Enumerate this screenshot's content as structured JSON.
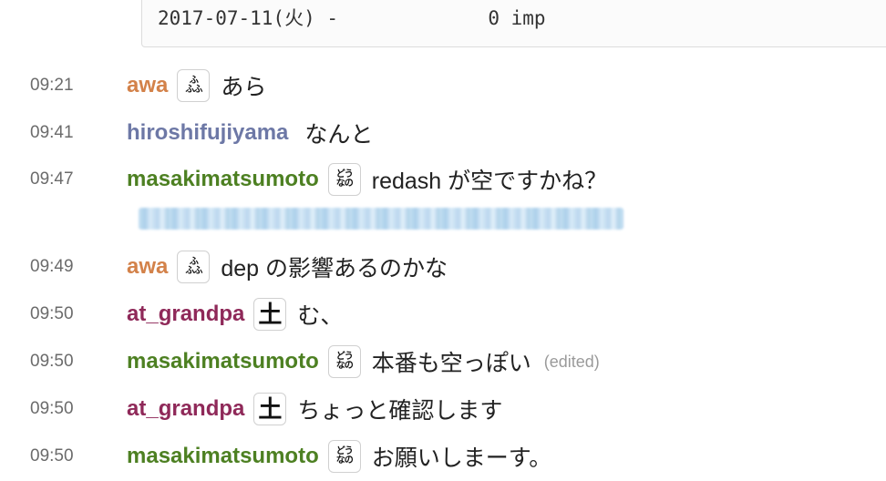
{
  "code_block": {
    "line": "2017-07-11(火) -             0 imp"
  },
  "colors": {
    "awa": "#d3824a",
    "hiroshifujiyama": "#6d78a6",
    "masakimatsumoto": "#4d8022",
    "at_grandpa": "#8f2959"
  },
  "messages": [
    {
      "time": "09:21",
      "user": "awa",
      "emoji": "fufufu-icon",
      "text": "あら"
    },
    {
      "time": "09:41",
      "user": "hiroshifujiyama",
      "text": "なんと"
    },
    {
      "time": "09:47",
      "user": "masakimatsumoto",
      "emoji": "dounano-icon",
      "text": "redash が空ですかね？"
    },
    {
      "time": "09:49",
      "user": "awa",
      "emoji": "fufufu-icon",
      "text": "dep の影響あるのかな"
    },
    {
      "time": "09:50",
      "user": "at_grandpa",
      "emoji": "tsuchi-icon",
      "text": "む、"
    },
    {
      "time": "09:50",
      "user": "masakimatsumoto",
      "emoji": "dounano-icon",
      "text": "本番も空っぽい",
      "edited": "(edited)"
    },
    {
      "time": "09:50",
      "user": "at_grandpa",
      "emoji": "tsuchi-icon",
      "text": "ちょっと確認します"
    },
    {
      "time": "09:50",
      "user": "masakimatsumoto",
      "emoji": "dounano-icon",
      "text": "お願いしまーす。"
    }
  ],
  "emoji_text": {
    "fufufu": {
      "line1": "ふ",
      "line2": "ふ",
      "line3": "ふ"
    },
    "dounano": {
      "line1": "どう",
      "line2": "なの"
    },
    "tsuchi": {
      "glyph": "土"
    }
  }
}
